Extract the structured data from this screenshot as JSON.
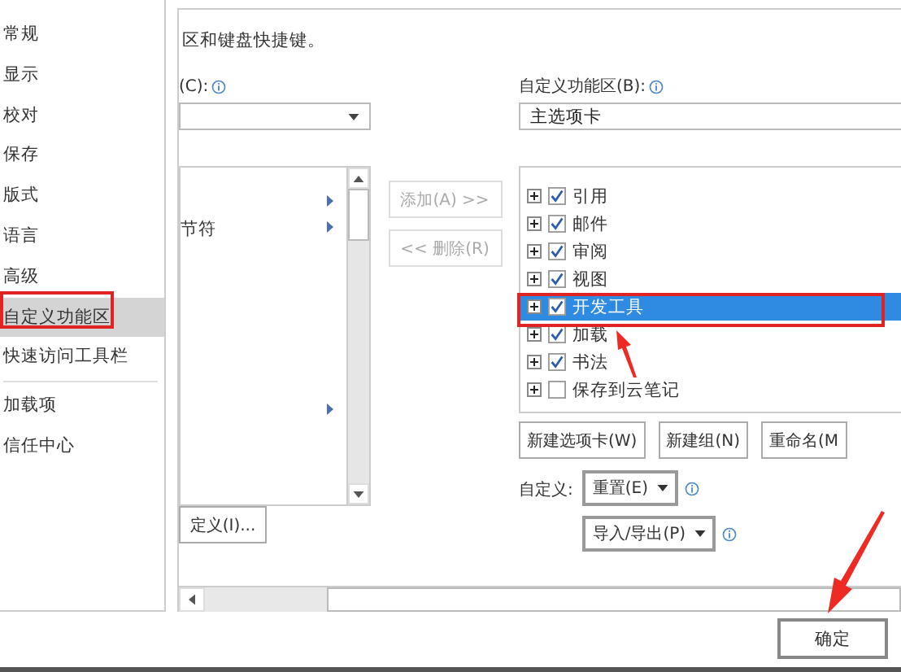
{
  "sidebar": {
    "items": [
      {
        "label": "常规",
        "selected": false
      },
      {
        "label": "显示",
        "selected": false
      },
      {
        "label": "校对",
        "selected": false
      },
      {
        "label": "保存",
        "selected": false
      },
      {
        "label": "版式",
        "selected": false
      },
      {
        "label": "语言",
        "selected": false
      },
      {
        "label": "高级",
        "selected": false
      },
      {
        "label": "自定义功能区",
        "selected": true
      },
      {
        "label": "快速访问工具栏",
        "selected": false
      },
      {
        "label": "加载项",
        "selected": false,
        "separator_before": true
      },
      {
        "label": "信任中心",
        "selected": false
      }
    ]
  },
  "intro_text": "区和键盘快捷键。",
  "commands": {
    "label": "(C):",
    "rows": [
      {
        "submenu": true
      },
      {
        "label": "节符",
        "submenu": true
      },
      {
        "submenu": false
      },
      {
        "submenu": false
      },
      {
        "submenu": false
      },
      {
        "submenu": false
      },
      {
        "submenu": false
      },
      {
        "submenu": false
      },
      {
        "submenu": true
      }
    ],
    "customize_button": "定义(I)..."
  },
  "add_button": {
    "label": "添加(A) >>",
    "disabled": true
  },
  "remove_button": {
    "label": "<< 删除(R)",
    "disabled": true
  },
  "ribbon": {
    "label": "自定义功能区(B):",
    "dropdown": "主选项卡",
    "tabs": [
      {
        "label": "引用",
        "checked": true,
        "selected": false
      },
      {
        "label": "邮件",
        "checked": true,
        "selected": false
      },
      {
        "label": "审阅",
        "checked": true,
        "selected": false
      },
      {
        "label": "视图",
        "checked": true,
        "selected": false
      },
      {
        "label": "开发工具",
        "checked": true,
        "selected": true
      },
      {
        "label": "加载",
        "checked": true,
        "selected": false
      },
      {
        "label": "书法",
        "checked": true,
        "selected": false
      },
      {
        "label": "保存到云笔记",
        "checked": false,
        "selected": false
      }
    ],
    "buttons": [
      "新建选项卡(W)",
      "新建组(N)",
      "重命名(M"
    ],
    "customize_label": "自定义:",
    "reset_button": "重置(E)",
    "import_export_button": "导入/导出(P)"
  },
  "ok_button": "确定"
}
